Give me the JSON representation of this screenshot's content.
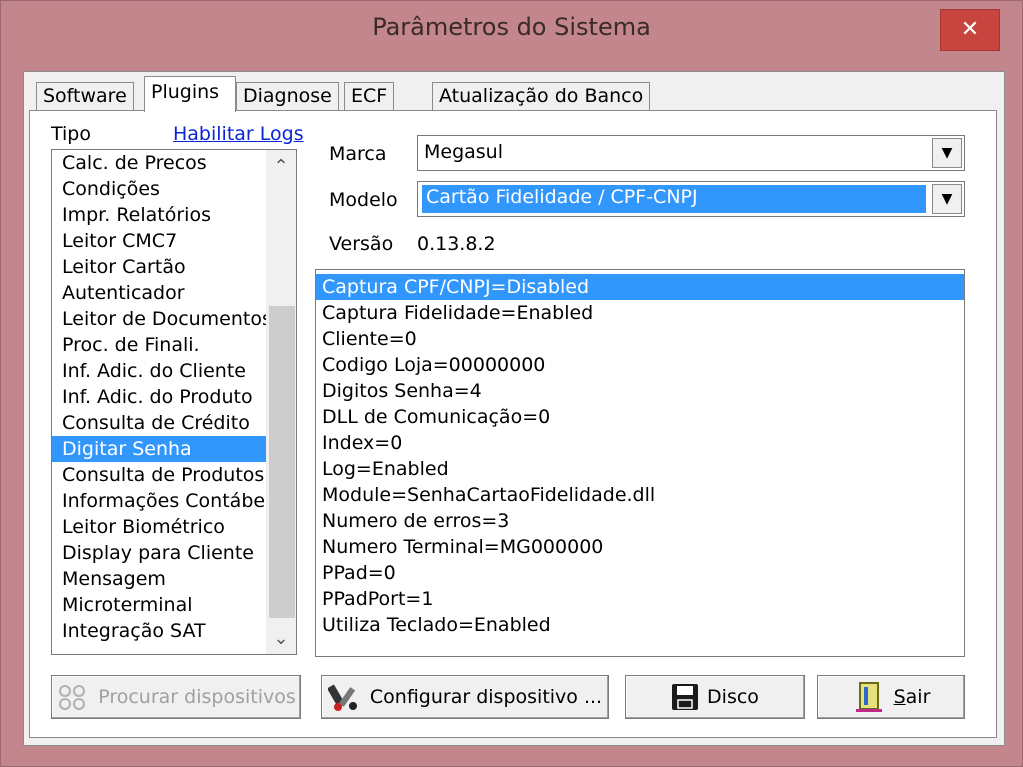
{
  "window": {
    "title": "Parâmetros do Sistema",
    "close_glyph": "✕"
  },
  "tabs": [
    {
      "label": "Software",
      "active": false
    },
    {
      "label": "Plugins",
      "active": true
    },
    {
      "label": "Diagnose",
      "active": false
    },
    {
      "label": "ECF",
      "active": false
    },
    {
      "label": "Atualização do Banco",
      "active": false
    }
  ],
  "left": {
    "tipo_label": "Tipo",
    "habilitar_logs": "Habilitar Logs",
    "items": [
      "Calc. de Precos",
      "Condições",
      "Impr. Relatórios",
      "Leitor CMC7",
      "Leitor Cartão",
      "Autenticador",
      "Leitor de Documentos",
      "Proc. de Finali.",
      "Inf. Adic. do Cliente",
      "Inf. Adic. do Produto",
      "Consulta de Crédito",
      "Digitar Senha",
      "Consulta de Produtos",
      "Informações Contábe",
      "Leitor Biométrico",
      "Display para Cliente",
      "Mensagem",
      "Microterminal",
      "Integração SAT"
    ],
    "selected_index": 11,
    "scroll_up": "⌃",
    "scroll_down": "⌄"
  },
  "right": {
    "marca_label": "Marca",
    "marca_value": "Megasul",
    "modelo_label": "Modelo",
    "modelo_value": "Cartão Fidelidade / CPF-CNPJ",
    "versao_label": "Versão",
    "versao_value": "0.13.8.2",
    "dropdown_glyph": "▼",
    "properties": [
      "Captura CPF/CNPJ=Disabled",
      "Captura Fidelidade=Enabled",
      "Cliente=0",
      "Codigo Loja=00000000",
      "Digitos Senha=4",
      "DLL de Comunicação=0",
      "Index=0",
      "Log=Enabled",
      "Module=SenhaCartaoFidelidade.dll",
      "Numero de erros=3",
      "Numero Terminal=MG000000",
      "PPad=0",
      "PPadPort=1",
      "Utiliza Teclado=Enabled"
    ],
    "selected_index": 0
  },
  "buttons": {
    "procurar": "Procurar dispositivos",
    "configurar": "Configurar dispositivo ...",
    "disco": "Disco",
    "sair_first": "S",
    "sair_rest": "air"
  },
  "colors": {
    "frame": "#c2868c",
    "close": "#c8443e",
    "selection": "#3297fd",
    "link": "#0b24d6"
  }
}
